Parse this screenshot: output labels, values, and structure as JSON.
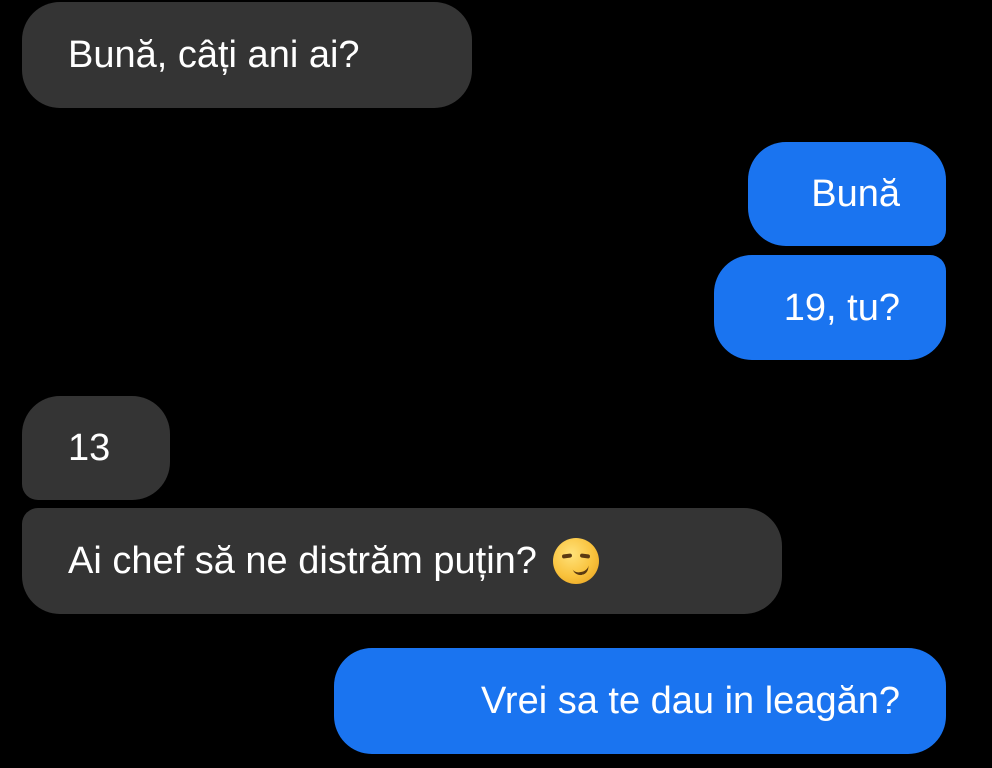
{
  "conversation": {
    "messages": [
      {
        "sender": "incoming",
        "text": "Bună, câți ani ai?"
      },
      {
        "sender": "outgoing",
        "text": "Bună"
      },
      {
        "sender": "outgoing",
        "text": "19, tu?"
      },
      {
        "sender": "incoming",
        "text": "13"
      },
      {
        "sender": "incoming",
        "text": "Ai chef să ne distrăm puțin?",
        "emoji": "smirking-face-icon"
      },
      {
        "sender": "outgoing",
        "text": "Vrei sa te dau in leagăn?"
      }
    ]
  },
  "colors": {
    "background": "#000000",
    "incoming_bubble": "#343434",
    "outgoing_bubble": "#1a74f0",
    "text": "#ffffff"
  }
}
